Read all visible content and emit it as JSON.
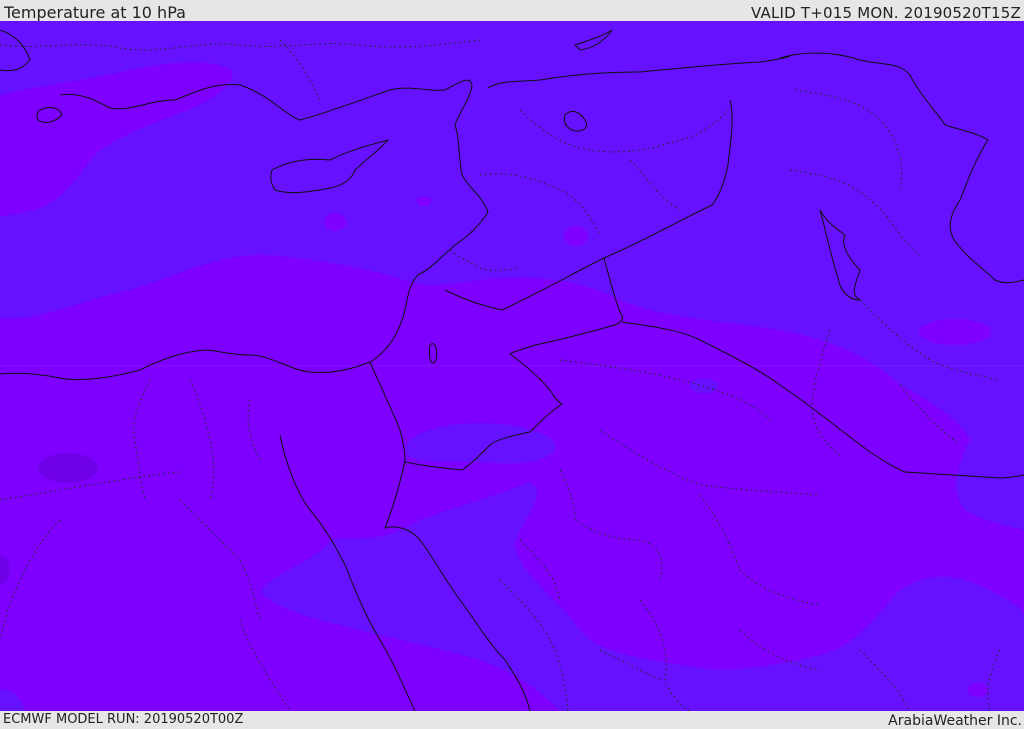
{
  "header": {
    "title": "Temperature at 10 hPa",
    "valid_time": "VALID T+015 MON. 20190520T15Z"
  },
  "footer": {
    "model_run": "ECMWF MODEL RUN: 20190520T00Z",
    "credit": "ArabiaWeather Inc."
  },
  "colors": {
    "band_cool": "#6611ff",
    "band_warm": "#7e00ff",
    "band_warmer": "#7000e8",
    "coastline": "#111111",
    "border_dotted": "#2a2a3a"
  }
}
